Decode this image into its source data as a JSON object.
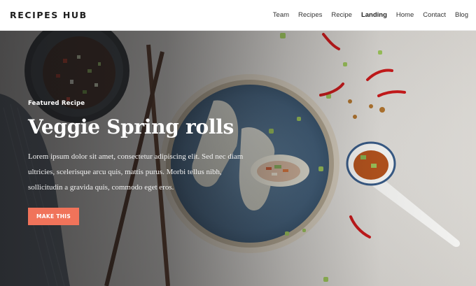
{
  "site": {
    "logo": "RECIPES HUB"
  },
  "nav": {
    "items": [
      {
        "label": "Team"
      },
      {
        "label": "Recipes"
      },
      {
        "label": "Recipe"
      },
      {
        "label": "Landing"
      },
      {
        "label": "Home"
      },
      {
        "label": "Contact"
      },
      {
        "label": "Blog"
      }
    ],
    "active": "Landing"
  },
  "hero": {
    "eyebrow": "Featured Recipe",
    "title": "Veggie Spring rolls",
    "text": "Lorem ipsum dolor sit amet, consectetur adipiscing elit. Sed nec diam ultricies, scelerisque arcu quis, mattis purus. Morbi tellus nibh, sollicitudin a gravida quis, commodo eget eros.",
    "button_label": "MAKE THIS"
  },
  "colors": {
    "accent": "#f0735a",
    "plate": "#4f6f8c",
    "header_bg": "#ffffff"
  }
}
